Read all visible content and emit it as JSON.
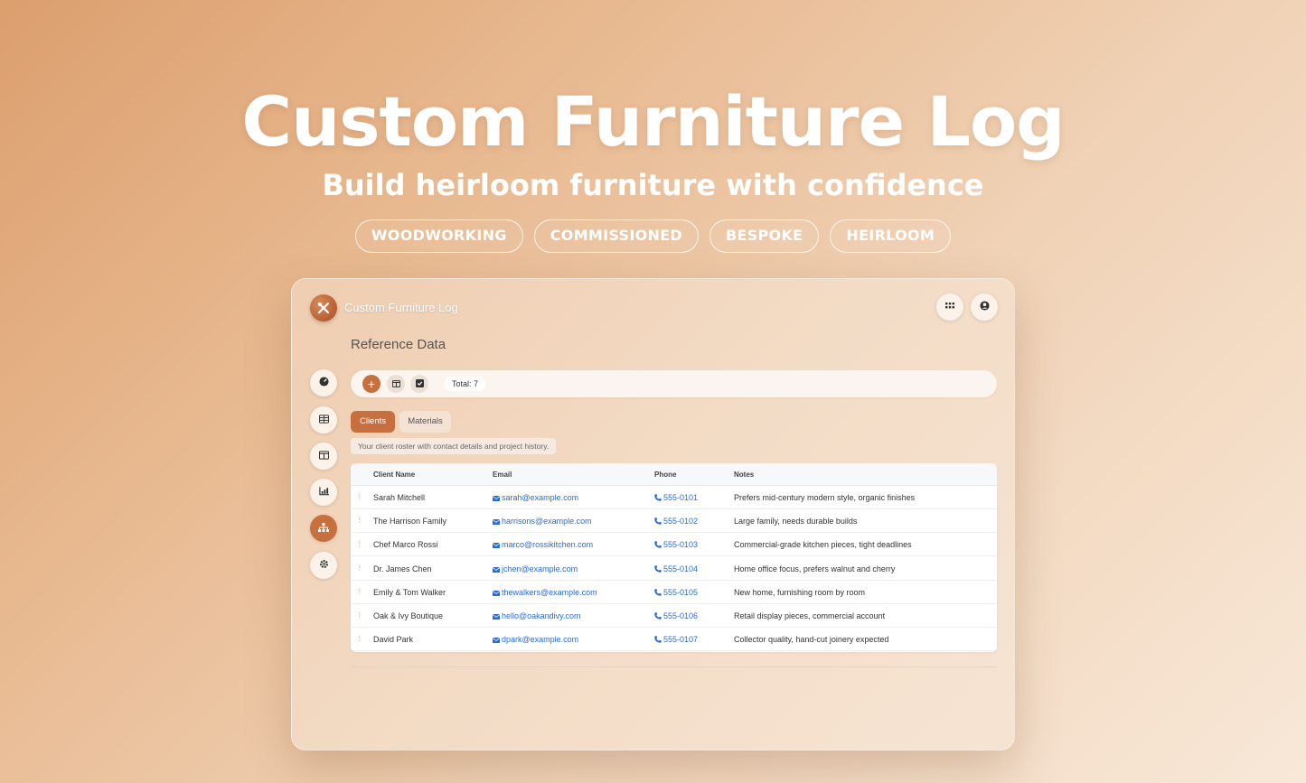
{
  "hero": {
    "title": "Custom Furniture Log",
    "subtitle": "Build heirloom furniture with confidence",
    "tags": [
      "WOODWORKING",
      "COMMISSIONED",
      "BESPOKE",
      "HEIRLOOM"
    ]
  },
  "app": {
    "title": "Custom Furniture Log",
    "page_title": "Reference Data",
    "icons": {
      "logo": "tools-icon",
      "apps": "grid-icon",
      "user": "user-circle-icon"
    }
  },
  "sidebar": {
    "items": [
      {
        "icon": "gauge-icon",
        "active": false
      },
      {
        "icon": "table-icon",
        "active": false
      },
      {
        "icon": "columns-icon",
        "active": false
      },
      {
        "icon": "chart-icon",
        "active": false
      },
      {
        "icon": "sitemap-icon",
        "active": true
      },
      {
        "icon": "gear-icon",
        "active": false
      }
    ]
  },
  "toolbar": {
    "add_label": "+",
    "total_label": "Total:",
    "total_value": "7"
  },
  "tabs": {
    "clients": "Clients",
    "materials": "Materials"
  },
  "description": "Your client roster with contact details and project history.",
  "table": {
    "headers": {
      "name": "Client Name",
      "email": "Email",
      "phone": "Phone",
      "notes": "Notes"
    },
    "rows": [
      {
        "name": "Sarah Mitchell",
        "email": "sarah@example.com",
        "phone": "555-0101",
        "notes": "Prefers mid-century modern style, organic finishes"
      },
      {
        "name": "The Harrison Family",
        "email": "harrisons@example.com",
        "phone": "555-0102",
        "notes": "Large family, needs durable builds"
      },
      {
        "name": "Chef Marco Rossi",
        "email": "marco@rossikitchen.com",
        "phone": "555-0103",
        "notes": "Commercial-grade kitchen pieces, tight deadlines"
      },
      {
        "name": "Dr. James Chen",
        "email": "jchen@example.com",
        "phone": "555-0104",
        "notes": "Home office focus, prefers walnut and cherry"
      },
      {
        "name": "Emily & Tom Walker",
        "email": "thewalkers@example.com",
        "phone": "555-0105",
        "notes": "New home, furnishing room by room"
      },
      {
        "name": "Oak & Ivy Boutique",
        "email": "hello@oakandivy.com",
        "phone": "555-0106",
        "notes": "Retail display pieces, commercial account"
      },
      {
        "name": "David Park",
        "email": "dpark@example.com",
        "phone": "555-0107",
        "notes": "Collector quality, hand-cut joinery expected"
      }
    ]
  },
  "colors": {
    "accent": "#c86f3f",
    "link": "#2b6cd4"
  }
}
